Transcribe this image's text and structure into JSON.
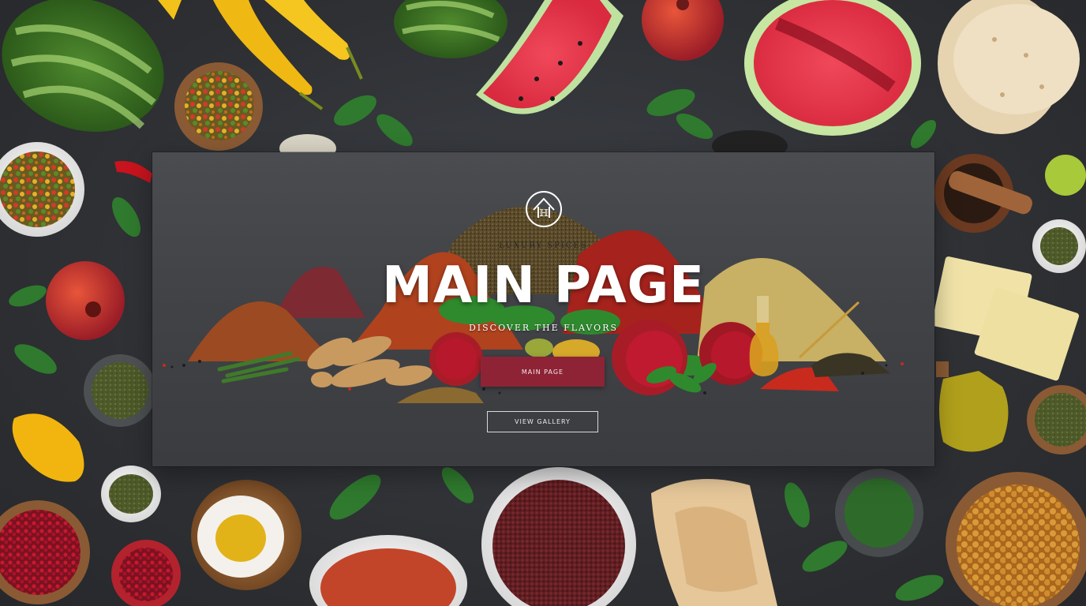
{
  "hero": {
    "brand": "LUXURY SPICES",
    "title": "MAIN PAGE",
    "subtitle": "DISCOVER THE FLAVORS",
    "primary_button": "MAIN PAGE",
    "secondary_button": "VIEW GALLERY"
  },
  "colors": {
    "background": "#2e3034",
    "panel": "#434549",
    "accent": "#8e2336",
    "title_text": "#ffffff"
  },
  "icons": {
    "logo": "spice-house-logo-icon"
  }
}
